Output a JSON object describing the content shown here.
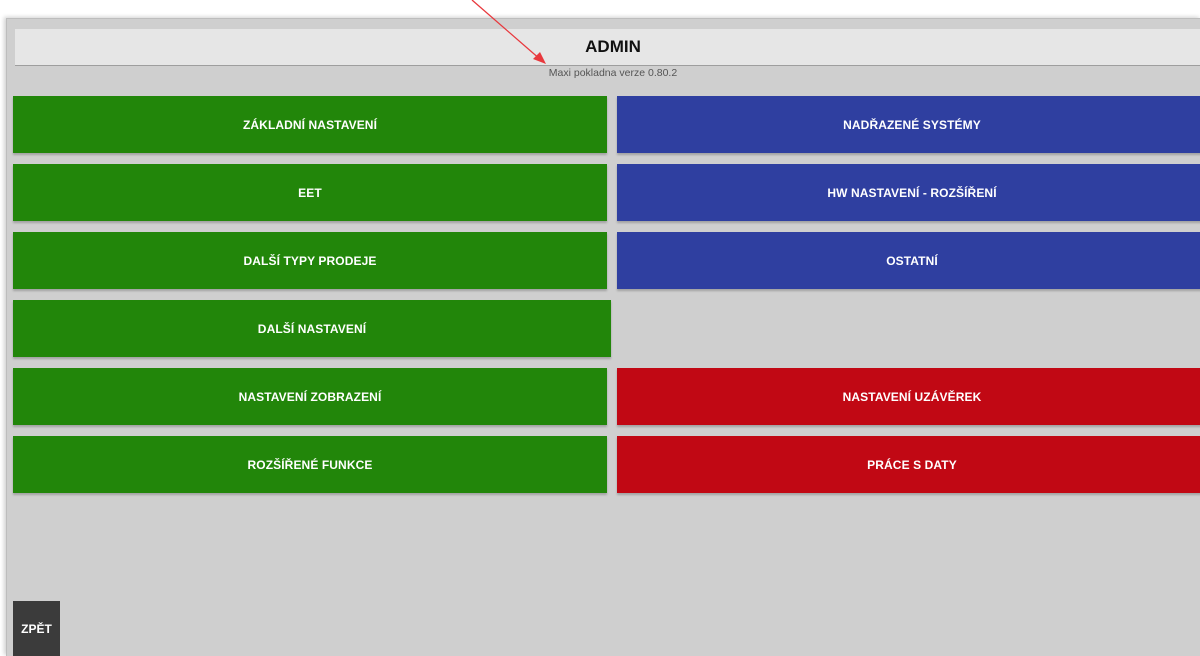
{
  "header": {
    "title": "ADMIN",
    "version": "Maxi pokladna verze 0.80.2"
  },
  "left_buttons": [
    {
      "label": "ZÁKLADNÍ NASTAVENÍ"
    },
    {
      "label": "EET"
    },
    {
      "label": "DALŠÍ TYPY PRODEJE"
    },
    {
      "label": "DALŠÍ NASTAVENÍ"
    },
    {
      "label": "NASTAVENÍ ZOBRAZENÍ"
    },
    {
      "label": "ROZŠÍŘENÉ FUNKCE"
    }
  ],
  "right_buttons": [
    {
      "label": "NADŘAZENÉ SYSTÉMY"
    },
    {
      "label": "HW NASTAVENÍ - ROZŠÍŘENÍ"
    },
    {
      "label": "OSTATNÍ"
    },
    {
      "label": "NASTAVENÍ UZÁVĚREK"
    },
    {
      "label": "PRÁCE S DATY"
    }
  ],
  "footer": {
    "back_label": "ZPĚT"
  },
  "colors": {
    "green": "#22860a",
    "blue": "#2f3fa0",
    "red": "#c10814",
    "background": "#cfcfcf",
    "annotation_arrow": "#e8383d"
  },
  "annotation": {
    "type": "arrow-pointer",
    "target": "version"
  }
}
